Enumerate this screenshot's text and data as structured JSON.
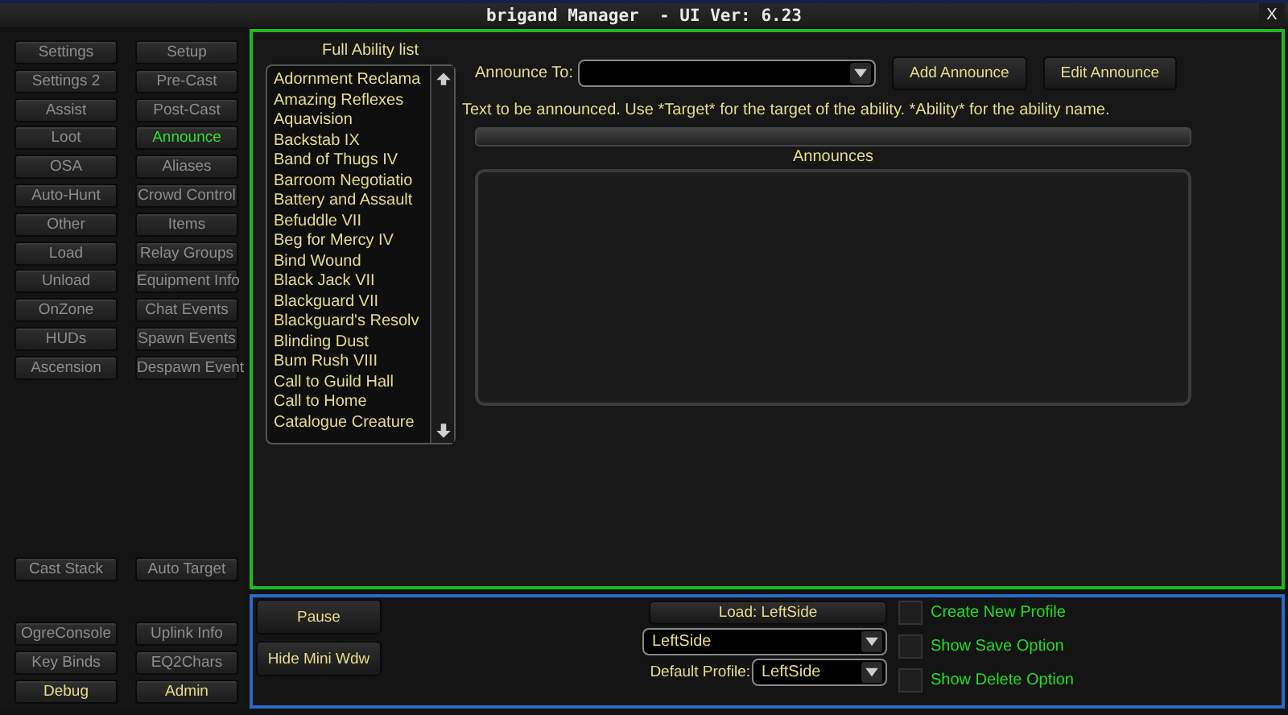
{
  "window": {
    "title": "brigand Manager  - UI Ver: 6.23",
    "close": "X"
  },
  "sidebar": {
    "nav_buttons": [
      {
        "label": "Settings",
        "selected": false
      },
      {
        "label": "Setup",
        "selected": false
      },
      {
        "label": "Settings 2",
        "selected": false
      },
      {
        "label": "Pre-Cast",
        "selected": false
      },
      {
        "label": "Assist",
        "selected": false
      },
      {
        "label": "Post-Cast",
        "selected": false
      },
      {
        "label": "Loot",
        "selected": false
      },
      {
        "label": "Announce",
        "selected": true
      },
      {
        "label": "OSA",
        "selected": false
      },
      {
        "label": "Aliases",
        "selected": false
      },
      {
        "label": "Auto-Hunt",
        "selected": false
      },
      {
        "label": "Crowd Control",
        "selected": false
      },
      {
        "label": "Other",
        "selected": false
      },
      {
        "label": "Items",
        "selected": false
      },
      {
        "label": "Load",
        "selected": false
      },
      {
        "label": "Relay Groups",
        "selected": false
      },
      {
        "label": "Unload",
        "selected": false
      },
      {
        "label": "Equipment Info",
        "selected": false
      },
      {
        "label": "OnZone",
        "selected": false
      },
      {
        "label": "Chat Events",
        "selected": false
      },
      {
        "label": "HUDs",
        "selected": false
      },
      {
        "label": "Spawn Events",
        "selected": false
      },
      {
        "label": "Ascension",
        "selected": false
      },
      {
        "label": "Despawn Event",
        "selected": false
      }
    ],
    "middle_buttons": [
      {
        "label": "Cast Stack",
        "kind": "plain"
      },
      {
        "label": "Auto Target",
        "kind": "plain"
      }
    ],
    "bottom_buttons": [
      {
        "label": "OgreConsole",
        "kind": "plain"
      },
      {
        "label": "Uplink Info",
        "kind": "plain"
      },
      {
        "label": "Key Binds",
        "kind": "plain"
      },
      {
        "label": "EQ2Chars",
        "kind": "plain"
      },
      {
        "label": "Debug",
        "kind": "accent"
      },
      {
        "label": "Admin",
        "kind": "accent"
      }
    ]
  },
  "ability_list": {
    "title": "Full Ability list",
    "items": [
      "Adornment Reclama",
      "Amazing Reflexes",
      "Aquavision",
      "Backstab IX",
      "Band of Thugs IV",
      "Barroom Negotiatio",
      "Battery and Assault",
      "Befuddle VII",
      "Beg for Mercy IV",
      "Bind Wound",
      "Black Jack VII",
      "Blackguard VII",
      "Blackguard's Resolv",
      "Blinding Dust",
      "Bum Rush VIII",
      "Call to Guild Hall",
      "Call to Home",
      "Catalogue Creature"
    ]
  },
  "announce": {
    "label": "Announce To:",
    "add_button": "Add Announce",
    "edit_button": "Edit Announce",
    "help": "Text to be announced. Use *Target* for the target of the ability. *Ability* for the ability name.",
    "list_title": "Announces"
  },
  "bottom_panel": {
    "pause_button": "Pause",
    "hide_button": "Hide Mini Wdw",
    "load_button": "Load: LeftSide",
    "profile_value": "LeftSide",
    "default_label": "Default Profile:",
    "default_value": "LeftSide",
    "options": [
      {
        "label": "Create New Profile",
        "checked": false
      },
      {
        "label": "Show Save Option",
        "checked": false
      },
      {
        "label": "Show Delete Option",
        "checked": false
      }
    ]
  }
}
